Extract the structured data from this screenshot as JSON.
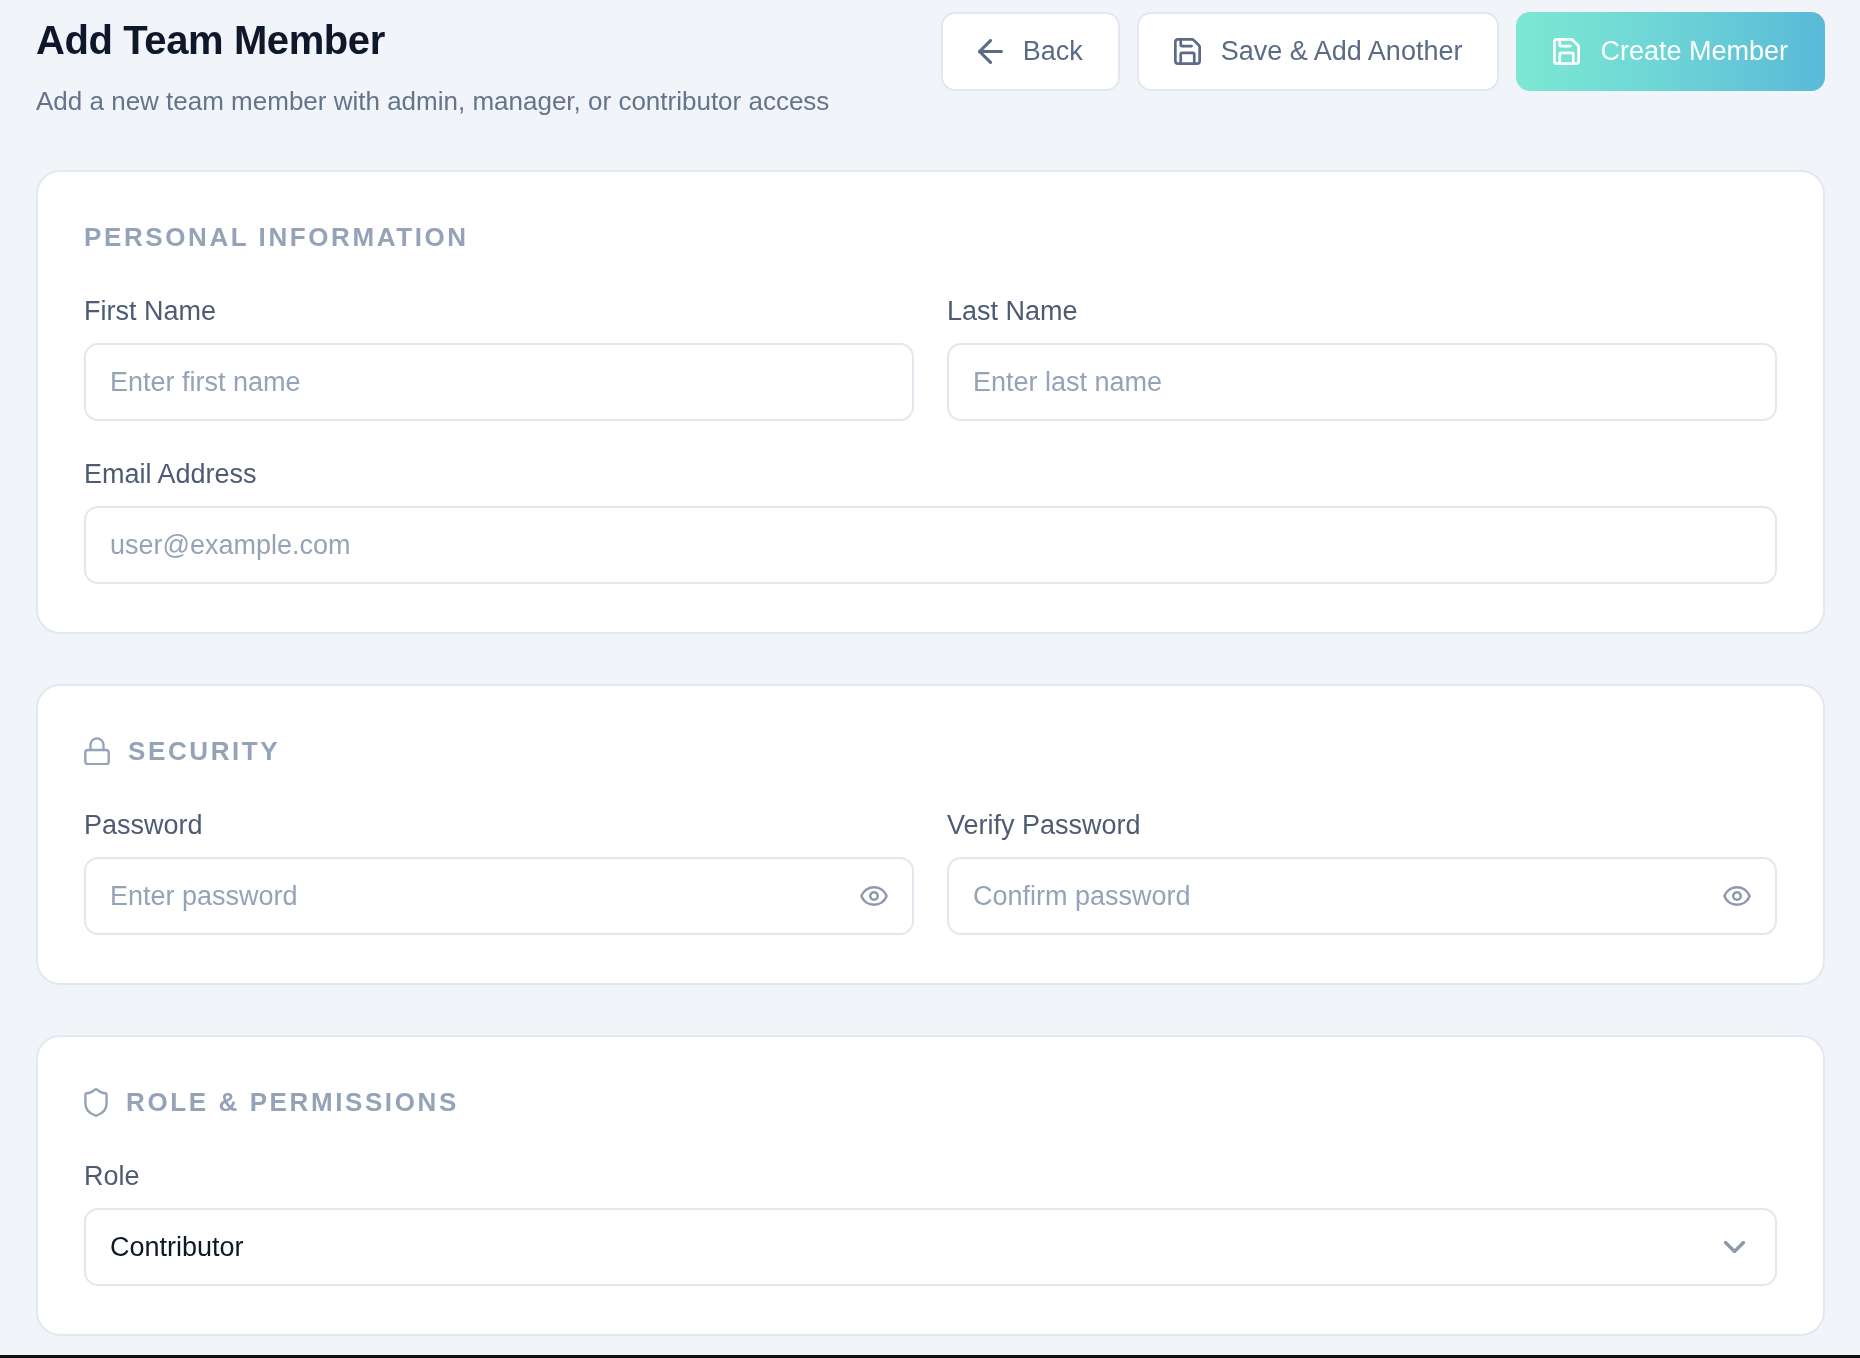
{
  "header": {
    "title": "Add Team Member",
    "subtitle": "Add a new team member with admin, manager, or contributor access"
  },
  "actions": [
    {
      "kind": "back",
      "label": "Back"
    },
    {
      "kind": "save-another",
      "label": "Save & Add Another"
    },
    {
      "kind": "create",
      "label": "Create Member"
    }
  ],
  "sections": [
    {
      "kind": "personal",
      "title": "PERSONAL INFORMATION",
      "rows": [
        {
          "fields": [
            {
              "kind": "text",
              "label": "First Name",
              "placeholder": "Enter first name"
            },
            {
              "kind": "text",
              "label": "Last Name",
              "placeholder": "Enter last name"
            }
          ]
        },
        {
          "fields": [
            {
              "kind": "text",
              "label": "Email Address",
              "placeholder": "user@example.com"
            }
          ]
        }
      ]
    },
    {
      "kind": "security",
      "title": "SECURITY",
      "rows": [
        {
          "fields": [
            {
              "kind": "password",
              "label": "Password",
              "placeholder": "Enter password"
            },
            {
              "kind": "password",
              "label": "Verify Password",
              "placeholder": "Confirm password"
            }
          ]
        }
      ]
    },
    {
      "kind": "role",
      "title": "ROLE & PERMISSIONS",
      "rows": [
        {
          "fields": [
            {
              "kind": "select",
              "label": "Role",
              "value": "Contributor"
            }
          ]
        }
      ]
    }
  ]
}
